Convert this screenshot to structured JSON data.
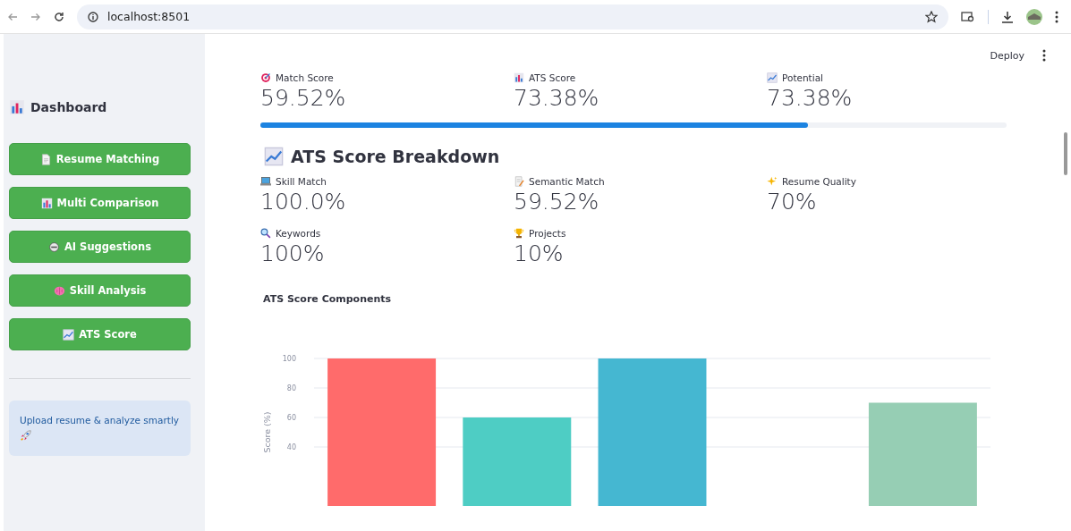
{
  "browser": {
    "url": "localhost:8501"
  },
  "toolbar": {
    "deploy": "Deploy"
  },
  "sidebar": {
    "title": "Dashboard",
    "buttons": [
      {
        "label": "Resume Matching"
      },
      {
        "label": "Multi Comparison"
      },
      {
        "label": "AI Suggestions"
      },
      {
        "label": "Skill Analysis"
      },
      {
        "label": "ATS Score"
      }
    ],
    "info": "Upload resume & analyze smartly"
  },
  "summary": [
    {
      "label": "Match Score",
      "value": "59.52%"
    },
    {
      "label": "ATS Score",
      "value": "73.38%"
    },
    {
      "label": "Potential",
      "value": "73.38%"
    }
  ],
  "progress": {
    "level": 0.7338
  },
  "breakdown": {
    "title": "ATS Score Breakdown",
    "metrics": [
      {
        "label": "Skill Match",
        "value": "100.0%"
      },
      {
        "label": "Semantic Match",
        "value": "59.52%"
      },
      {
        "label": "Resume Quality",
        "value": "70%"
      },
      {
        "label": "Keywords",
        "value": "100%"
      },
      {
        "label": "Projects",
        "value": "10%"
      }
    ]
  },
  "chart": {
    "title": "ATS Score Components",
    "chart_data": {
      "type": "bar",
      "ylabel": "Score (%)",
      "yticks": [
        40,
        60,
        80,
        100
      ],
      "ylim": [
        0,
        100
      ],
      "grid": true,
      "series": [
        {
          "values": [
            100,
            60,
            100,
            null,
            70
          ]
        }
      ],
      "colors": [
        "#ff6b6b",
        "#4ecdc4",
        "#45b7d1",
        null,
        "#96ceb4"
      ]
    }
  }
}
